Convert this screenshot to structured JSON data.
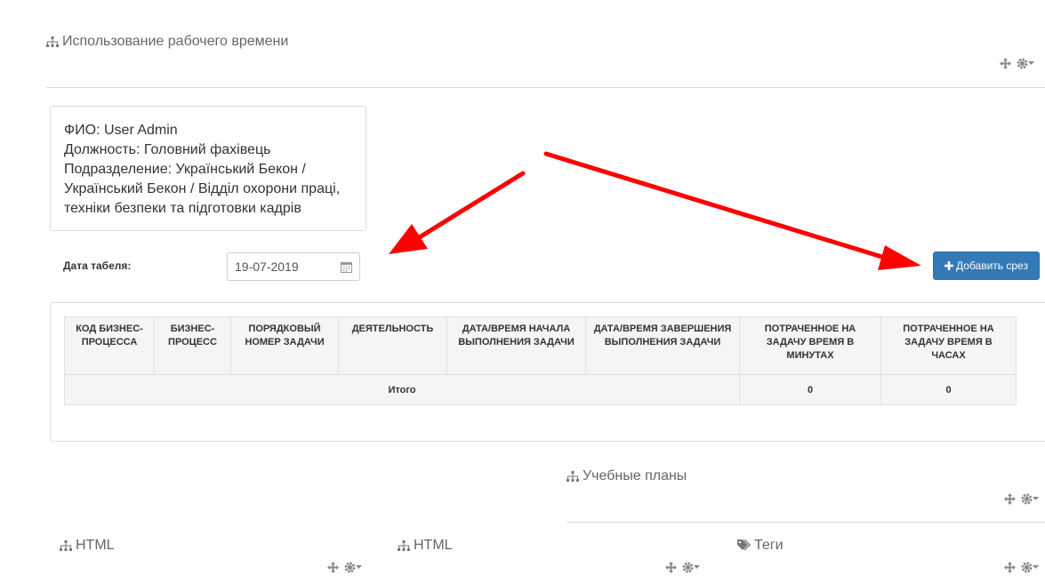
{
  "blocks": {
    "work_time_title": "Использование рабочего времени",
    "study_plans_title": "Учебные планы",
    "html1_title": "HTML",
    "html2_title": "HTML",
    "tags_title": "Теги"
  },
  "icons": {
    "block_icon": "sitemap-icon",
    "tags_icon": "tag-icon",
    "move": "move-icon",
    "settings": "gear-icon"
  },
  "employee": {
    "fio": "ФИО: User Admin",
    "position": "Должность: Головний фахівець",
    "department_line1": "Подразделение: Український Бекон /",
    "department_line2": "Український Бекон / Відділ охорони праці,",
    "department_line3": "техніки безпеки та підготовки кадрів"
  },
  "form": {
    "date_label": "Дата табеля:",
    "date_value": "19-07-2019",
    "add_button": "Добавить срез"
  },
  "table": {
    "headers": [
      "КОД БИЗНЕС-ПРОЦЕССА",
      "БИЗНЕС-ПРОЦЕСС",
      "ПОРЯДКОВЫЙ НОМЕР ЗАДАЧИ",
      "ДЕЯТЕЛЬНОСТЬ",
      "ДАТА/ВРЕМЯ НАЧАЛА ВЫПОЛНЕНИЯ ЗАДАЧИ",
      "ДАТА/ВРЕМЯ ЗАВЕРШЕНИЯ ВЫПОЛНЕНИЯ ЗАДАЧИ",
      "ПОТРАЧЕННОЕ НА ЗАДАЧУ ВРЕМЯ В МИНУТАХ",
      "ПОТРАЧЕННОЕ НА ЗАДАЧУ ВРЕМЯ В ЧАСАХ"
    ],
    "total_label": "Итого",
    "total_minutes": "0",
    "total_hours": "0"
  },
  "colors": {
    "primary": "#337ab7",
    "arrow": "#ff0000"
  }
}
